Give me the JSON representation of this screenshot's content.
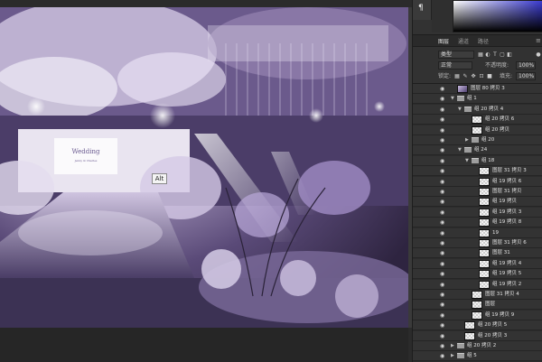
{
  "canvas": {
    "alt_tooltip": "Alt",
    "wedding_sign_title": "Wedding",
    "wedding_sign_sub": "Jenny & Charles"
  },
  "panel": {
    "tabs": [
      "图层",
      "通道",
      "路径"
    ],
    "filter_label": "类型",
    "blend_mode": "正常",
    "opacity_label": "不透明度:",
    "opacity_value": "100%",
    "lock_label": "锁定:",
    "fill_label": "填充:",
    "fill_value": "100%"
  },
  "layers": [
    {
      "name": "图层 80 拷贝 3",
      "indent": 0,
      "kind": "image",
      "expanded": null,
      "selected": false
    },
    {
      "name": "组 1",
      "indent": 0,
      "kind": "group",
      "expanded": true,
      "selected": false
    },
    {
      "name": "组 20 拷贝 4",
      "indent": 1,
      "kind": "group",
      "expanded": true,
      "selected": false
    },
    {
      "name": "组 20 拷贝 6",
      "indent": 2,
      "kind": "layer",
      "expanded": null,
      "selected": false
    },
    {
      "name": "组 20 拷贝",
      "indent": 2,
      "kind": "layer",
      "expanded": null,
      "selected": false
    },
    {
      "name": "组 20",
      "indent": 2,
      "kind": "group",
      "expanded": false,
      "selected": false
    },
    {
      "name": "组 24",
      "indent": 1,
      "kind": "group",
      "expanded": true,
      "selected": false
    },
    {
      "name": "组 18",
      "indent": 2,
      "kind": "group",
      "expanded": true,
      "selected": false
    },
    {
      "name": "图层 31 拷贝 3",
      "indent": 3,
      "kind": "layer",
      "expanded": null,
      "selected": false
    },
    {
      "name": "组 19 拷贝 6",
      "indent": 3,
      "kind": "layer",
      "expanded": null,
      "selected": false
    },
    {
      "name": "图层 31 拷贝",
      "indent": 3,
      "kind": "layer",
      "expanded": null,
      "selected": false
    },
    {
      "name": "组 19 拷贝",
      "indent": 3,
      "kind": "layer",
      "expanded": null,
      "selected": false
    },
    {
      "name": "组 19 拷贝 3",
      "indent": 3,
      "kind": "layer",
      "expanded": null,
      "selected": false
    },
    {
      "name": "组 19 拷贝 8",
      "indent": 3,
      "kind": "layer",
      "expanded": null,
      "selected": false
    },
    {
      "name": "19",
      "indent": 3,
      "kind": "layer",
      "expanded": null,
      "selected": false
    },
    {
      "name": "图层 31 拷贝 6",
      "indent": 3,
      "kind": "layer",
      "expanded": null,
      "selected": false
    },
    {
      "name": "图层 31",
      "indent": 3,
      "kind": "layer",
      "expanded": null,
      "selected": false
    },
    {
      "name": "组 19 拷贝 4",
      "indent": 3,
      "kind": "layer",
      "expanded": null,
      "selected": false
    },
    {
      "name": "组 19 拷贝 5",
      "indent": 3,
      "kind": "layer",
      "expanded": null,
      "selected": false
    },
    {
      "name": "组 19 拷贝 2",
      "indent": 3,
      "kind": "layer",
      "expanded": null,
      "selected": false
    },
    {
      "name": "图层 31 拷贝 4",
      "indent": 2,
      "kind": "layer",
      "expanded": null,
      "selected": false
    },
    {
      "name": "图层",
      "indent": 2,
      "kind": "layer",
      "expanded": null,
      "selected": false
    },
    {
      "name": "组 19 拷贝 9",
      "indent": 2,
      "kind": "layer",
      "expanded": null,
      "selected": false
    },
    {
      "name": "组 20 拷贝 5",
      "indent": 1,
      "kind": "layer",
      "expanded": null,
      "selected": false
    },
    {
      "name": "组 20 拷贝 3",
      "indent": 1,
      "kind": "layer",
      "expanded": null,
      "selected": false
    },
    {
      "name": "组 20 拷贝 2",
      "indent": 0,
      "kind": "group",
      "expanded": false,
      "selected": false
    },
    {
      "name": "组 5",
      "indent": 0,
      "kind": "group",
      "expanded": false,
      "selected": false
    }
  ]
}
